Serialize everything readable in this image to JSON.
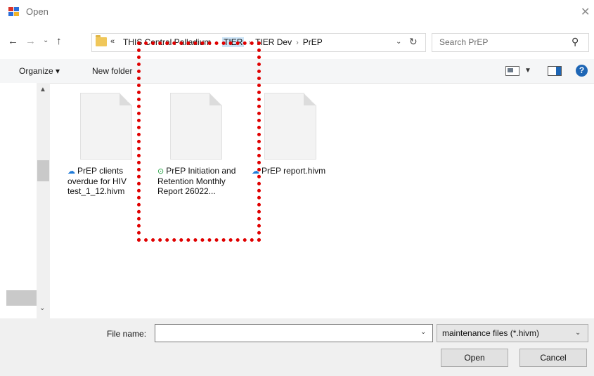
{
  "window": {
    "title": "Open"
  },
  "address": {
    "crumbs": [
      "THIS Central Palladium",
      "TIER",
      "TIER Dev",
      "PrEP"
    ],
    "overflow_glyph": "«"
  },
  "search": {
    "placeholder": "Search PrEP"
  },
  "toolbar": {
    "organize_label": "Organize ▾",
    "new_folder_label": "New folder"
  },
  "files": [
    {
      "name": "PrEP clients overdue for HIV test_1_12.hivm",
      "status": "cloud"
    },
    {
      "name": "PrEP Initiation and Retention Monthly Report 26022...",
      "status": "synced"
    },
    {
      "name": "PrEP report.hivm",
      "status": "cloud"
    }
  ],
  "bottom": {
    "filename_label": "File name:",
    "filename_value": "",
    "filetype_value": "maintenance files (*.hivm)",
    "open_label": "Open",
    "cancel_label": "Cancel"
  },
  "colors": {
    "accent": "#1e66b5",
    "annotation": "#e00000",
    "cloud_icon": "#1e7ad8",
    "synced_icon": "#1e9e3e"
  },
  "icons": {
    "back": "arrow-left-icon",
    "forward": "arrow-right-icon",
    "up": "arrow-up-icon",
    "refresh": "refresh-icon",
    "search": "search-icon",
    "help": "help-icon"
  }
}
